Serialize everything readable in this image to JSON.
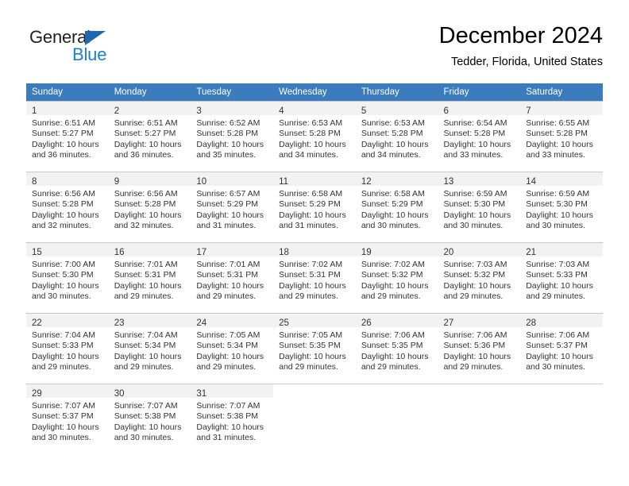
{
  "logo": {
    "word_top": "General",
    "word_bottom": "Blue",
    "triangle_color": "#1b68b0",
    "blue_color": "#1b7fd4",
    "top_color": "#231f20"
  },
  "header": {
    "title": "December 2024",
    "location": "Tedder, Florida, United States"
  },
  "colors": {
    "header_blue": "#3a7cbe",
    "daynum_band": "#f2f2f2",
    "grid_line": "#c9c9c9",
    "text": "#333333"
  },
  "weekdays": [
    "Sunday",
    "Monday",
    "Tuesday",
    "Wednesday",
    "Thursday",
    "Friday",
    "Saturday"
  ],
  "labels": {
    "sunrise": "Sunrise:",
    "sunset": "Sunset:",
    "daylight": "Daylight:"
  },
  "weeks": [
    [
      {
        "day": "1",
        "sunrise": "Sunrise: 6:51 AM",
        "sunset": "Sunset: 5:27 PM",
        "daylight": "Daylight: 10 hours and 36 minutes."
      },
      {
        "day": "2",
        "sunrise": "Sunrise: 6:51 AM",
        "sunset": "Sunset: 5:27 PM",
        "daylight": "Daylight: 10 hours and 36 minutes."
      },
      {
        "day": "3",
        "sunrise": "Sunrise: 6:52 AM",
        "sunset": "Sunset: 5:28 PM",
        "daylight": "Daylight: 10 hours and 35 minutes."
      },
      {
        "day": "4",
        "sunrise": "Sunrise: 6:53 AM",
        "sunset": "Sunset: 5:28 PM",
        "daylight": "Daylight: 10 hours and 34 minutes."
      },
      {
        "day": "5",
        "sunrise": "Sunrise: 6:53 AM",
        "sunset": "Sunset: 5:28 PM",
        "daylight": "Daylight: 10 hours and 34 minutes."
      },
      {
        "day": "6",
        "sunrise": "Sunrise: 6:54 AM",
        "sunset": "Sunset: 5:28 PM",
        "daylight": "Daylight: 10 hours and 33 minutes."
      },
      {
        "day": "7",
        "sunrise": "Sunrise: 6:55 AM",
        "sunset": "Sunset: 5:28 PM",
        "daylight": "Daylight: 10 hours and 33 minutes."
      }
    ],
    [
      {
        "day": "8",
        "sunrise": "Sunrise: 6:56 AM",
        "sunset": "Sunset: 5:28 PM",
        "daylight": "Daylight: 10 hours and 32 minutes."
      },
      {
        "day": "9",
        "sunrise": "Sunrise: 6:56 AM",
        "sunset": "Sunset: 5:28 PM",
        "daylight": "Daylight: 10 hours and 32 minutes."
      },
      {
        "day": "10",
        "sunrise": "Sunrise: 6:57 AM",
        "sunset": "Sunset: 5:29 PM",
        "daylight": "Daylight: 10 hours and 31 minutes."
      },
      {
        "day": "11",
        "sunrise": "Sunrise: 6:58 AM",
        "sunset": "Sunset: 5:29 PM",
        "daylight": "Daylight: 10 hours and 31 minutes."
      },
      {
        "day": "12",
        "sunrise": "Sunrise: 6:58 AM",
        "sunset": "Sunset: 5:29 PM",
        "daylight": "Daylight: 10 hours and 30 minutes."
      },
      {
        "day": "13",
        "sunrise": "Sunrise: 6:59 AM",
        "sunset": "Sunset: 5:30 PM",
        "daylight": "Daylight: 10 hours and 30 minutes."
      },
      {
        "day": "14",
        "sunrise": "Sunrise: 6:59 AM",
        "sunset": "Sunset: 5:30 PM",
        "daylight": "Daylight: 10 hours and 30 minutes."
      }
    ],
    [
      {
        "day": "15",
        "sunrise": "Sunrise: 7:00 AM",
        "sunset": "Sunset: 5:30 PM",
        "daylight": "Daylight: 10 hours and 30 minutes."
      },
      {
        "day": "16",
        "sunrise": "Sunrise: 7:01 AM",
        "sunset": "Sunset: 5:31 PM",
        "daylight": "Daylight: 10 hours and 29 minutes."
      },
      {
        "day": "17",
        "sunrise": "Sunrise: 7:01 AM",
        "sunset": "Sunset: 5:31 PM",
        "daylight": "Daylight: 10 hours and 29 minutes."
      },
      {
        "day": "18",
        "sunrise": "Sunrise: 7:02 AM",
        "sunset": "Sunset: 5:31 PM",
        "daylight": "Daylight: 10 hours and 29 minutes."
      },
      {
        "day": "19",
        "sunrise": "Sunrise: 7:02 AM",
        "sunset": "Sunset: 5:32 PM",
        "daylight": "Daylight: 10 hours and 29 minutes."
      },
      {
        "day": "20",
        "sunrise": "Sunrise: 7:03 AM",
        "sunset": "Sunset: 5:32 PM",
        "daylight": "Daylight: 10 hours and 29 minutes."
      },
      {
        "day": "21",
        "sunrise": "Sunrise: 7:03 AM",
        "sunset": "Sunset: 5:33 PM",
        "daylight": "Daylight: 10 hours and 29 minutes."
      }
    ],
    [
      {
        "day": "22",
        "sunrise": "Sunrise: 7:04 AM",
        "sunset": "Sunset: 5:33 PM",
        "daylight": "Daylight: 10 hours and 29 minutes."
      },
      {
        "day": "23",
        "sunrise": "Sunrise: 7:04 AM",
        "sunset": "Sunset: 5:34 PM",
        "daylight": "Daylight: 10 hours and 29 minutes."
      },
      {
        "day": "24",
        "sunrise": "Sunrise: 7:05 AM",
        "sunset": "Sunset: 5:34 PM",
        "daylight": "Daylight: 10 hours and 29 minutes."
      },
      {
        "day": "25",
        "sunrise": "Sunrise: 7:05 AM",
        "sunset": "Sunset: 5:35 PM",
        "daylight": "Daylight: 10 hours and 29 minutes."
      },
      {
        "day": "26",
        "sunrise": "Sunrise: 7:06 AM",
        "sunset": "Sunset: 5:35 PM",
        "daylight": "Daylight: 10 hours and 29 minutes."
      },
      {
        "day": "27",
        "sunrise": "Sunrise: 7:06 AM",
        "sunset": "Sunset: 5:36 PM",
        "daylight": "Daylight: 10 hours and 29 minutes."
      },
      {
        "day": "28",
        "sunrise": "Sunrise: 7:06 AM",
        "sunset": "Sunset: 5:37 PM",
        "daylight": "Daylight: 10 hours and 30 minutes."
      }
    ],
    [
      {
        "day": "29",
        "sunrise": "Sunrise: 7:07 AM",
        "sunset": "Sunset: 5:37 PM",
        "daylight": "Daylight: 10 hours and 30 minutes."
      },
      {
        "day": "30",
        "sunrise": "Sunrise: 7:07 AM",
        "sunset": "Sunset: 5:38 PM",
        "daylight": "Daylight: 10 hours and 30 minutes."
      },
      {
        "day": "31",
        "sunrise": "Sunrise: 7:07 AM",
        "sunset": "Sunset: 5:38 PM",
        "daylight": "Daylight: 10 hours and 31 minutes."
      },
      {
        "day": "",
        "sunrise": "",
        "sunset": "",
        "daylight": ""
      },
      {
        "day": "",
        "sunrise": "",
        "sunset": "",
        "daylight": ""
      },
      {
        "day": "",
        "sunrise": "",
        "sunset": "",
        "daylight": ""
      },
      {
        "day": "",
        "sunrise": "",
        "sunset": "",
        "daylight": ""
      }
    ]
  ]
}
